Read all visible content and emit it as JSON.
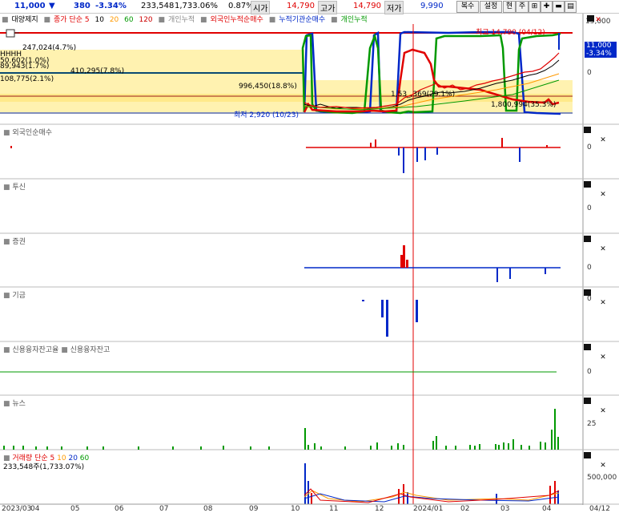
{
  "header": {
    "price": "11,000",
    "change": "380",
    "change_pct": "-3.34%",
    "volume": "233,548",
    "volume_pct": "1,733.06%",
    "ratio": "0.87%",
    "open_label": "시가",
    "open_value": "14,790",
    "high_label": "고가",
    "high_value": "14,790",
    "low_label": "저가",
    "low_value": "9,990",
    "buttons": [
      "복수",
      "설정",
      "현",
      "주"
    ]
  },
  "main_legend": {
    "items": [
      {
        "label": "대양제지",
        "color": "#000000"
      },
      {
        "label": "종가 단순 5",
        "color": "#e00000"
      },
      {
        "label": "10",
        "color": "#000000"
      },
      {
        "label": "20",
        "color": "#ff9900"
      },
      {
        "label": "60",
        "color": "#009900"
      },
      {
        "label": "120",
        "color": "#cc0000"
      },
      {
        "label": "개인누적",
        "color": "#888888"
      },
      {
        "label": "외국인누적순매수",
        "color": "#e00000"
      },
      {
        "label": "누적기관순매수",
        "color": "#0028c8"
      },
      {
        "label": "개인누적",
        "color": "#009900"
      }
    ]
  },
  "price_panel": {
    "labels": {
      "vp1": "247,024(4.7%)",
      "vp2": "HHHH",
      "vp3": "50,602(1.0%)",
      "vp4": "89,943(1.7%)",
      "vp5": "410,295(7.8%)",
      "vp6": "108,775(2.1%)",
      "vp7": "996,450(18.8%)",
      "vp8": "1,53_,369(29.1%)",
      "vp9": "1,800,994(35.3%)",
      "high": "최고 14,790 (04/12)",
      "low": "최저 2,920 (10/23)"
    },
    "axis": {
      "top": "15,000",
      "zero": "0"
    },
    "current_price": "11,000",
    "current_pct": "-3.34%"
  },
  "panels": [
    {
      "title": "외국인순매수",
      "zero": "0"
    },
    {
      "title": "투신",
      "zero": "0"
    },
    {
      "title": "증권",
      "zero": "0"
    },
    {
      "title": "기금",
      "zero": "0"
    },
    {
      "title": "신용융자잔고율",
      "title2": "신용융자잔고",
      "zero": "0"
    },
    {
      "title": "뉴스",
      "tick": "25"
    },
    {
      "title": "거래량",
      "title2": "단순 5 10 20 60",
      "value": "233,548주(1,733.07%)",
      "tick": "500,000"
    }
  ],
  "volume_legend": {
    "label": "거래량",
    "items": [
      "단순",
      "5",
      "10",
      "20",
      "60"
    ],
    "colors": [
      "#e00000",
      "#e00000",
      "#ff9900",
      "#0028c8",
      "#009900"
    ]
  },
  "x_axis": [
    "2023/03",
    "04",
    "05",
    "06",
    "07",
    "08",
    "09",
    "10",
    "11",
    "12",
    "2024/01",
    "02",
    "03",
    "04",
    "04/12"
  ],
  "colors": {
    "up": "#e00000",
    "down": "#0028c8",
    "ma20": "#ff9900",
    "ma60": "#009900",
    "band": "#fff2b0",
    "crosshair": "#e00000"
  }
}
